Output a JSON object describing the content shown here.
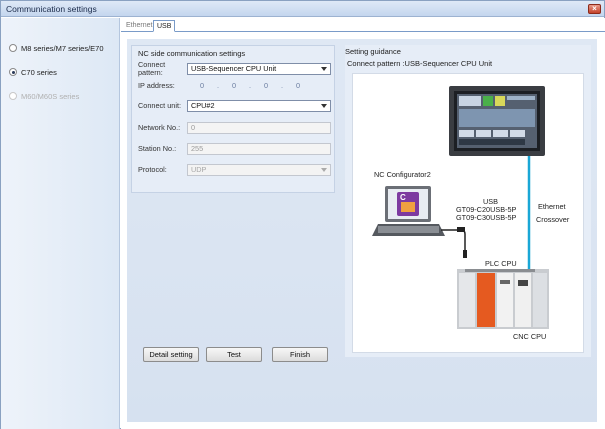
{
  "window": {
    "title": "Communication settings",
    "close_glyph": "×"
  },
  "sidebar": {
    "series": [
      {
        "label": "M8 series/M7 series/E70",
        "checked": false,
        "disabled": false
      },
      {
        "label": "C70 series",
        "checked": true,
        "disabled": false
      },
      {
        "label": "M60/M60S series",
        "checked": false,
        "disabled": true
      }
    ]
  },
  "tabs": [
    {
      "label": "Ethernet",
      "active": false
    },
    {
      "label": "USB",
      "active": true
    }
  ],
  "nc_settings": {
    "title": "NC side communication settings",
    "connect_pattern_label": "Connect\npattern:",
    "connect_pattern_value": "USB-Sequencer CPU Unit",
    "ip_label": "IP address:",
    "ip_values": [
      "0",
      "0",
      "0",
      "0"
    ],
    "connect_unit_label": "Connect unit:",
    "connect_unit_value": "CPU#2",
    "network_label": "Network No.:",
    "network_value": "0",
    "station_label": "Station No.:",
    "station_value": "255",
    "protocol_label": "Protocol:",
    "protocol_value": "UDP"
  },
  "guidance": {
    "title": "Setting guidance",
    "pattern_text": "Connect pattern :USB-Sequencer CPU Unit",
    "nc_configurator": "NC Configurator2",
    "usb_line1": "USB",
    "usb_line2": "GT09-C20USB-5P",
    "usb_line3": "GT09-C30USB-5P",
    "ethernet_line1": "Ethernet",
    "ethernet_line2": "Crossover",
    "plc_cpu": "PLC CPU",
    "cnc_cpu": "CNC CPU",
    "connection_color": "#1aa7d6"
  },
  "buttons": {
    "detail": "Detail setting",
    "test": "Test",
    "finish": "Finish"
  }
}
